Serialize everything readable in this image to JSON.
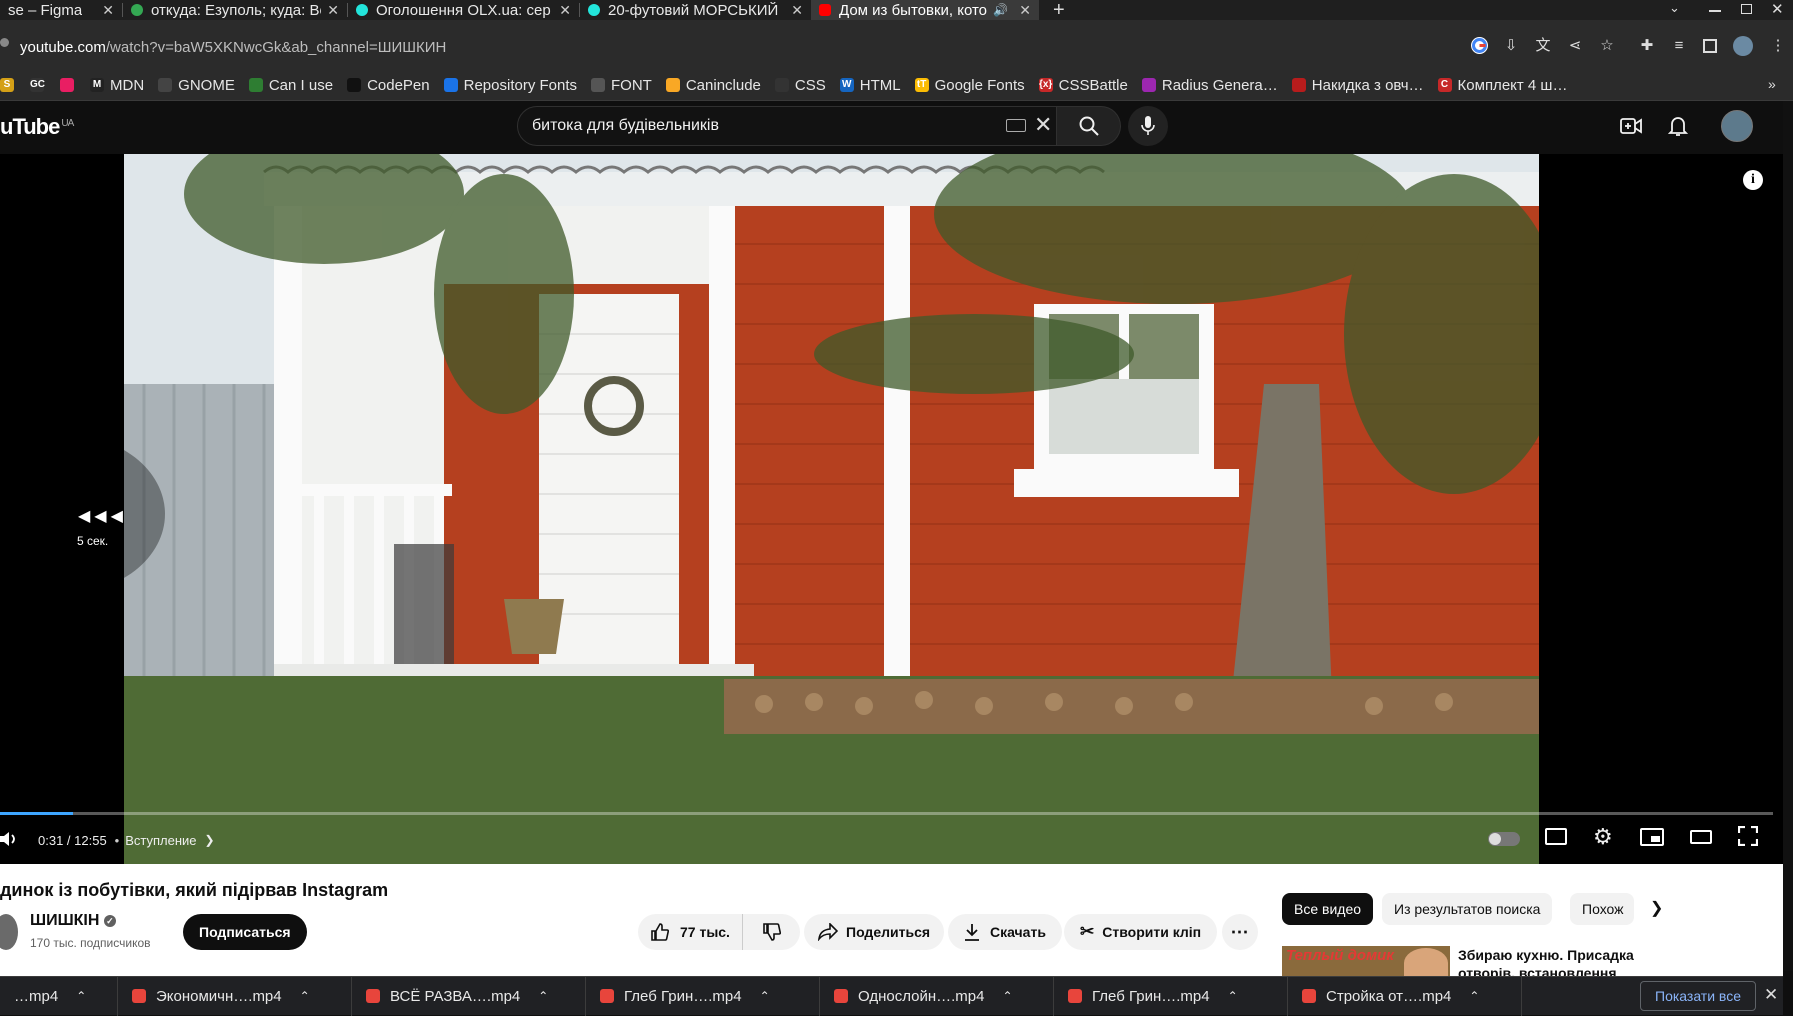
{
  "tabs": [
    {
      "title": "se – Figma",
      "color": "#a259ff"
    },
    {
      "title": "откуда: Езуполь; куда: Во",
      "color": "#34a853"
    },
    {
      "title": "Оголошення OLX.ua: сер",
      "color": "#23e5db"
    },
    {
      "title": "20-футовий МОРСЬКИЙ",
      "color": "#23e5db"
    },
    {
      "title": "Дом из бытовки, кото",
      "color": "#ff0000",
      "active": true
    }
  ],
  "tab_close_glyph": "✕",
  "new_tab_glyph": "+",
  "url": {
    "host": "youtube.com",
    "path": "/watch?v=baW5XKNwcGk&ab_channel=ШИШКИН"
  },
  "bookmarks": [
    {
      "label": "",
      "icon_color": "#d4a017",
      "glyph": "S"
    },
    {
      "label": "",
      "icon_color": "#333",
      "glyph": "GC"
    },
    {
      "label": "",
      "icon_color": "#e91e63",
      "glyph": ""
    },
    {
      "label": "MDN",
      "icon_color": "#222",
      "glyph": "M"
    },
    {
      "label": "GNOME",
      "icon_color": "#444",
      "glyph": ""
    },
    {
      "label": "Can I use",
      "icon_color": "#2e7d32",
      "glyph": ""
    },
    {
      "label": "CodePen",
      "icon_color": "#111",
      "glyph": ""
    },
    {
      "label": "Repository Fonts",
      "icon_color": "#1a73e8",
      "glyph": ""
    },
    {
      "label": "FONT",
      "icon_color": "#555",
      "glyph": ""
    },
    {
      "label": "Caninclude",
      "icon_color": "#f9a825",
      "glyph": ""
    },
    {
      "label": "CSS",
      "icon_color": "#333",
      "glyph": ""
    },
    {
      "label": "HTML",
      "icon_color": "#1565c0",
      "glyph": "W"
    },
    {
      "label": "Google Fonts",
      "icon_color": "#fbbc04",
      "glyph": "tT"
    },
    {
      "label": "CSSBattle",
      "icon_color": "#c62828",
      "glyph": "{x}"
    },
    {
      "label": "Radius Genera…",
      "icon_color": "#9c27b0",
      "glyph": ""
    },
    {
      "label": "Накидка з овч…",
      "icon_color": "#b71c1c",
      "glyph": ""
    },
    {
      "label": "Комплект 4 ш…",
      "icon_color": "#c62828",
      "glyph": "C"
    }
  ],
  "youtube": {
    "logo": "uTube",
    "region": "UA",
    "search_value": "битока для будівельників"
  },
  "player": {
    "seek_label": "5 сек.",
    "time": "0:31 / 12:55",
    "chapter": "Вступление",
    "progress": 0.041
  },
  "video": {
    "title": "динок із побутівки, який підірвав Instagram",
    "channel": "ШИШКІН",
    "subscribers": "170 тыс. подписчиков",
    "subscribe_label": "Подписаться",
    "likes": "77 тыс.",
    "share_label": "Поделиться",
    "download_label": "Скачать",
    "clip_label": "Створити кліп"
  },
  "chips": [
    "Все видео",
    "Из результатов поиска",
    "Похож"
  ],
  "recommendation": {
    "thumb_text": "Теплый домик",
    "title": "Збираю кухню. Присадка отворів, встановлення"
  },
  "downloads": [
    {
      "name": "…mp4"
    },
    {
      "name": "Экономичн….mp4"
    },
    {
      "name": "ВСЁ РАЗВА….mp4"
    },
    {
      "name": "Глеб Грин….mp4"
    },
    {
      "name": "Однослойн….mp4"
    },
    {
      "name": "Глеб Грин….mp4"
    },
    {
      "name": "Стройка от….mp4"
    }
  ],
  "show_all_label": "Показати все",
  "colors": {
    "accent": "#3ea6ff",
    "house_red": "#b5401f",
    "youtube_red": "#ff0000"
  }
}
